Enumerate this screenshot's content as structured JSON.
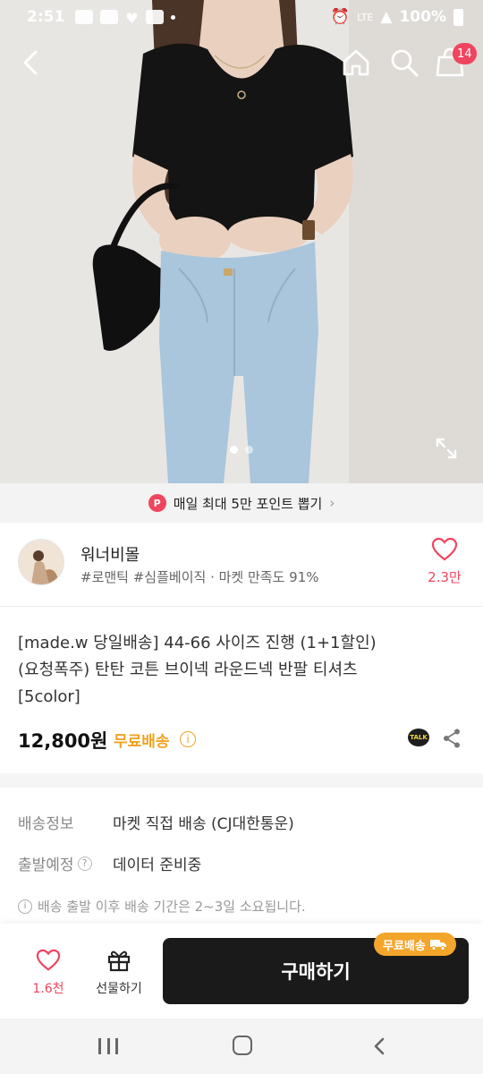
{
  "status_bar": {
    "time": "2:51",
    "network": "LTE",
    "battery": "100%"
  },
  "cart": {
    "badge_count": "14"
  },
  "promo": {
    "badge": "P",
    "text": "매일 최대 5만 포인트 뽑기",
    "chevron": "›"
  },
  "seller": {
    "name": "워너비몰",
    "tags": "#로맨틱 #심플베이직 · 마켓 만족도 91%",
    "like_count": "2.3만"
  },
  "product": {
    "title_line1": "[made.w 당일배송] 44-66 사이즈 진행 (1+1할인)",
    "title_line2": "(요청폭주) 탄탄 코튼 브이넥 라운드넥 반팔 티셔츠",
    "title_line3": "[5color]",
    "price": "12,800원",
    "free_shipping": "무료배송",
    "info_glyph": "i",
    "talk_label": "TALK"
  },
  "shipping": {
    "info_label": "배송정보",
    "info_value": "마켓 직접 배송 (CJ대한통운)",
    "departure_label": "출발예정",
    "departure_help": "?",
    "departure_value": "데이터 준비중",
    "note_glyph": "i",
    "note": "배송 출발 이후 배송 기간은 2~3일 소요됩니다."
  },
  "bottom_bar": {
    "wish_count": "1.6천",
    "gift_label": "선물하기",
    "buy_label": "구매하기",
    "buy_badge": "무료배송"
  },
  "icons": {
    "back": "chevron-left-icon",
    "home": "home-icon",
    "search": "search-icon",
    "cart": "shopping-bag-icon",
    "expand": "expand-icon",
    "heart": "heart-icon",
    "gift": "gift-icon",
    "share": "share-icon",
    "truck": "truck-icon"
  },
  "colors": {
    "accent_pink": "#f0455e",
    "accent_orange": "#f0a323",
    "buy_button": "#1a1a1a"
  },
  "gallery": {
    "page_count": 2,
    "active_page": 1
  }
}
